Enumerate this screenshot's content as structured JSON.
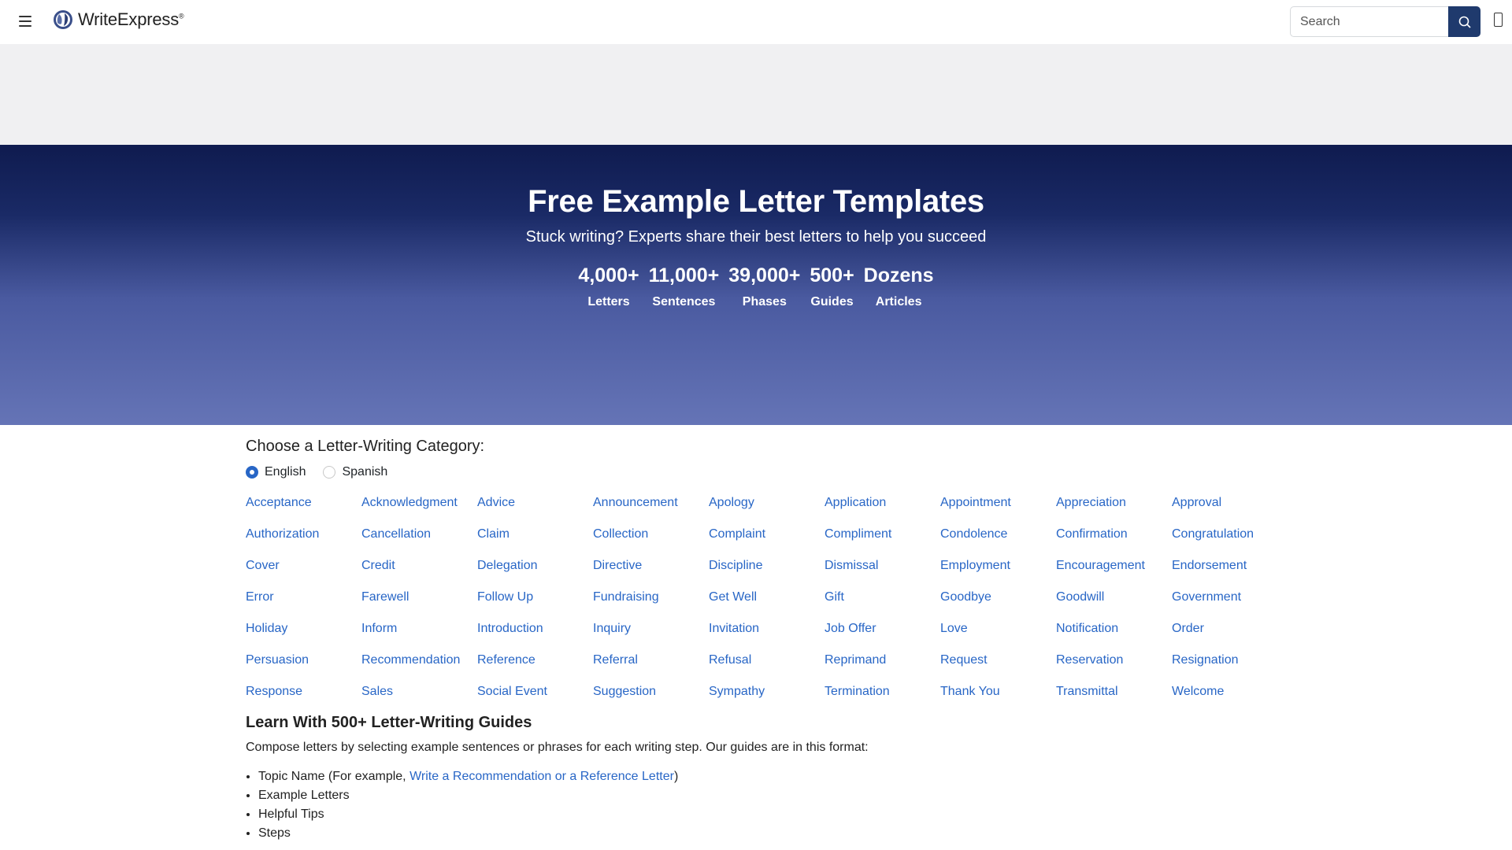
{
  "header": {
    "brand": "WriteExpress",
    "brand_mark": "®",
    "search_placeholder": "Search",
    "icons": {
      "menu": "hamburger-menu-icon",
      "logo": "globe-logo-icon",
      "search": "search-icon",
      "phone": "phone-icon"
    },
    "accent_color": "#1f3a6d"
  },
  "hero": {
    "title": "Free Example Letter Templates",
    "subtitle": "Stuck writing? Experts share their best letters to help you succeed",
    "stats": [
      {
        "value": "4,000+",
        "label": "Letters"
      },
      {
        "value": "11,000+",
        "label": "Sentences"
      },
      {
        "value": "39,000+",
        "label": "Phases"
      },
      {
        "value": "500+",
        "label": "Guides"
      },
      {
        "value": "Dozens",
        "label": "Articles"
      }
    ]
  },
  "categories": {
    "title": "Choose a Letter-Writing Category:",
    "languages": [
      {
        "label": "English",
        "selected": true
      },
      {
        "label": "Spanish",
        "selected": false
      }
    ],
    "items": [
      "Acceptance",
      "Acknowledgment",
      "Advice",
      "Announcement",
      "Apology",
      "Application",
      "Appointment",
      "Appreciation",
      "Approval",
      "Authorization",
      "Cancellation",
      "Claim",
      "Collection",
      "Complaint",
      "Compliment",
      "Condolence",
      "Confirmation",
      "Congratulation",
      "Cover",
      "Credit",
      "Delegation",
      "Directive",
      "Discipline",
      "Dismissal",
      "Employment",
      "Encouragement",
      "Endorsement",
      "Error",
      "Farewell",
      "Follow Up",
      "Fundraising",
      "Get Well",
      "Gift",
      "Goodbye",
      "Goodwill",
      "Government",
      "Holiday",
      "Inform",
      "Introduction",
      "Inquiry",
      "Invitation",
      "Job Offer",
      "Love",
      "Notification",
      "Order",
      "Persuasion",
      "Recommendation",
      "Reference",
      "Referral",
      "Refusal",
      "Reprimand",
      "Request",
      "Reservation",
      "Resignation",
      "Response",
      "Sales",
      "Social Event",
      "Suggestion",
      "Sympathy",
      "Termination",
      "Thank You",
      "Transmittal",
      "Welcome"
    ],
    "link_color": "#2866c6"
  },
  "guides": {
    "title": "Learn With 500+ Letter-Writing Guides",
    "description": "Compose letters by selecting example sentences or phrases for each writing step. Our guides are in this format:",
    "list": {
      "topic_prefix": "Topic Name (For example, ",
      "topic_link": "Write a Recommendation or a Reference Letter",
      "topic_suffix": ")",
      "items": [
        "Example Letters",
        "Helpful Tips",
        "Steps"
      ]
    }
  }
}
